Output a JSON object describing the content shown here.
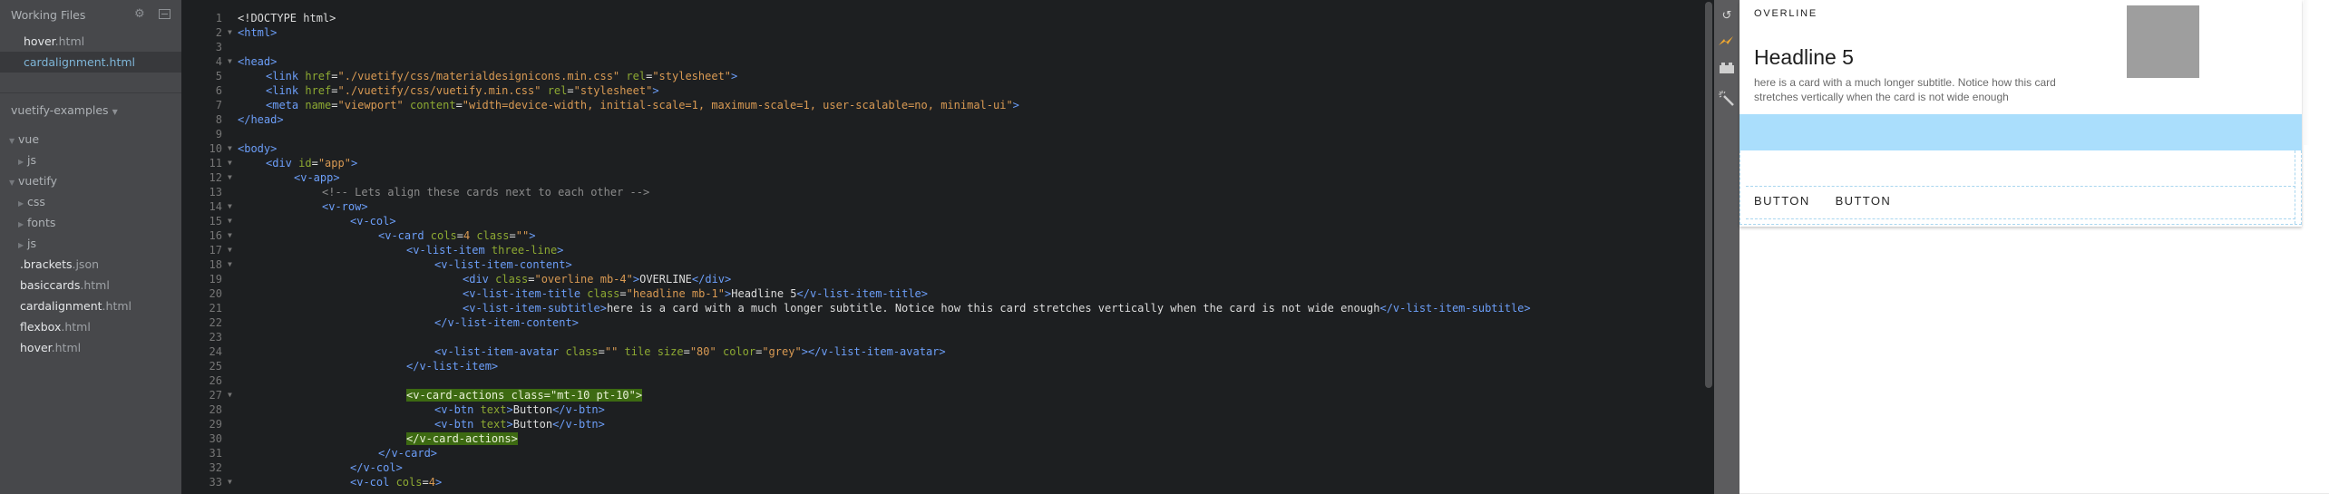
{
  "sidebar": {
    "working_files_title": "Working Files",
    "working_files": [
      {
        "base": "hover",
        "ext": ".html",
        "active": false
      },
      {
        "base": "cardalignment",
        "ext": ".html",
        "active": true
      }
    ],
    "project_title": "vuetify-examples",
    "tree": [
      {
        "depth": 0,
        "type": "folder",
        "open": true,
        "name": "vue"
      },
      {
        "depth": 1,
        "type": "folder",
        "open": false,
        "name": "js"
      },
      {
        "depth": 0,
        "type": "folder",
        "open": true,
        "name": "vuetify"
      },
      {
        "depth": 1,
        "type": "folder",
        "open": false,
        "name": "css"
      },
      {
        "depth": 1,
        "type": "folder",
        "open": false,
        "name": "fonts"
      },
      {
        "depth": 1,
        "type": "folder",
        "open": false,
        "name": "js"
      },
      {
        "depth": 0,
        "type": "file",
        "base": ".brackets",
        "ext": ".json"
      },
      {
        "depth": 0,
        "type": "file",
        "base": "basiccards",
        "ext": ".html"
      },
      {
        "depth": 0,
        "type": "file",
        "base": "cardalignment",
        "ext": ".html"
      },
      {
        "depth": 0,
        "type": "file",
        "base": "flexbox",
        "ext": ".html"
      },
      {
        "depth": 0,
        "type": "file",
        "base": "hover",
        "ext": ".html"
      }
    ]
  },
  "editor": {
    "lines": [
      {
        "n": 1,
        "fold": false,
        "indent": 0,
        "tokens": [
          [
            "p",
            "<!DOCTYPE html>"
          ]
        ]
      },
      {
        "n": 2,
        "fold": true,
        "indent": 0,
        "tokens": [
          [
            "t",
            "<html>"
          ]
        ]
      },
      {
        "n": 3,
        "fold": false,
        "indent": 0,
        "tokens": []
      },
      {
        "n": 4,
        "fold": true,
        "indent": 0,
        "tokens": [
          [
            "t",
            "<head>"
          ]
        ]
      },
      {
        "n": 5,
        "fold": false,
        "indent": 1,
        "tokens": [
          [
            "t",
            "<link "
          ],
          [
            "a",
            "href"
          ],
          [
            "p",
            "="
          ],
          [
            "s",
            "\"./vuetify/css/materialdesignicons.min.css\""
          ],
          [
            "p",
            " "
          ],
          [
            "a",
            "rel"
          ],
          [
            "p",
            "="
          ],
          [
            "s",
            "\"stylesheet\""
          ],
          [
            "t",
            ">"
          ]
        ]
      },
      {
        "n": 6,
        "fold": false,
        "indent": 1,
        "tokens": [
          [
            "t",
            "<link "
          ],
          [
            "a",
            "href"
          ],
          [
            "p",
            "="
          ],
          [
            "s",
            "\"./vuetify/css/vuetify.min.css\""
          ],
          [
            "p",
            " "
          ],
          [
            "a",
            "rel"
          ],
          [
            "p",
            "="
          ],
          [
            "s",
            "\"stylesheet\""
          ],
          [
            "t",
            ">"
          ]
        ]
      },
      {
        "n": 7,
        "fold": false,
        "indent": 1,
        "tokens": [
          [
            "t",
            "<meta "
          ],
          [
            "a",
            "name"
          ],
          [
            "p",
            "="
          ],
          [
            "s",
            "\"viewport\""
          ],
          [
            "p",
            " "
          ],
          [
            "a",
            "content"
          ],
          [
            "p",
            "="
          ],
          [
            "s",
            "\"width=device-width, initial-scale=1, maximum-scale=1, user-scalable=no, minimal-ui\""
          ],
          [
            "t",
            ">"
          ]
        ]
      },
      {
        "n": 8,
        "fold": false,
        "indent": 0,
        "tokens": [
          [
            "t",
            "</head>"
          ]
        ]
      },
      {
        "n": 9,
        "fold": false,
        "indent": 0,
        "tokens": []
      },
      {
        "n": 10,
        "fold": true,
        "indent": 0,
        "tokens": [
          [
            "t",
            "<body>"
          ]
        ]
      },
      {
        "n": 11,
        "fold": true,
        "indent": 1,
        "tokens": [
          [
            "t",
            "<div "
          ],
          [
            "a",
            "id"
          ],
          [
            "p",
            "="
          ],
          [
            "s",
            "\"app\""
          ],
          [
            "t",
            ">"
          ]
        ]
      },
      {
        "n": 12,
        "fold": true,
        "indent": 2,
        "tokens": [
          [
            "t",
            "<v-app>"
          ]
        ]
      },
      {
        "n": 13,
        "fold": false,
        "indent": 3,
        "tokens": [
          [
            "c",
            "<!-- Lets align these cards next to each other -->"
          ]
        ]
      },
      {
        "n": 14,
        "fold": true,
        "indent": 3,
        "tokens": [
          [
            "t",
            "<v-row>"
          ]
        ]
      },
      {
        "n": 15,
        "fold": true,
        "indent": 4,
        "tokens": [
          [
            "t",
            "<v-col>"
          ]
        ]
      },
      {
        "n": 16,
        "fold": true,
        "indent": 5,
        "tokens": [
          [
            "t",
            "<v-card "
          ],
          [
            "a",
            "cols"
          ],
          [
            "p",
            "="
          ],
          [
            "s",
            "4"
          ],
          [
            "p",
            " "
          ],
          [
            "a",
            "class"
          ],
          [
            "p",
            "="
          ],
          [
            "s",
            "\"\""
          ],
          [
            "t",
            ">"
          ]
        ]
      },
      {
        "n": 17,
        "fold": true,
        "indent": 6,
        "tokens": [
          [
            "t",
            "<v-list-item "
          ],
          [
            "a",
            "three-line"
          ],
          [
            "t",
            ">"
          ]
        ]
      },
      {
        "n": 18,
        "fold": true,
        "indent": 7,
        "tokens": [
          [
            "t",
            "<v-list-item-content>"
          ]
        ]
      },
      {
        "n": 19,
        "fold": false,
        "indent": 8,
        "tokens": [
          [
            "t",
            "<div "
          ],
          [
            "a",
            "class"
          ],
          [
            "p",
            "="
          ],
          [
            "s",
            "\"overline mb-4\""
          ],
          [
            "t",
            ">"
          ],
          [
            "p",
            "OVERLINE"
          ],
          [
            "t",
            "</div>"
          ]
        ]
      },
      {
        "n": 20,
        "fold": false,
        "indent": 8,
        "tokens": [
          [
            "t",
            "<v-list-item-title "
          ],
          [
            "a",
            "class"
          ],
          [
            "p",
            "="
          ],
          [
            "s",
            "\"headline mb-1\""
          ],
          [
            "t",
            ">"
          ],
          [
            "p",
            "Headline 5"
          ],
          [
            "t",
            "</v-list-item-title>"
          ]
        ]
      },
      {
        "n": 21,
        "fold": false,
        "indent": 8,
        "tokens": [
          [
            "t",
            "<v-list-item-subtitle>"
          ],
          [
            "p",
            "here is a card with a much longer subtitle. Notice how this card stretches vertically when the card is not wide enough"
          ],
          [
            "t",
            "</v-list-item-subtitle>"
          ]
        ]
      },
      {
        "n": 22,
        "fold": false,
        "indent": 7,
        "tokens": [
          [
            "t",
            "</v-list-item-content>"
          ]
        ]
      },
      {
        "n": 23,
        "fold": false,
        "indent": 0,
        "tokens": []
      },
      {
        "n": 24,
        "fold": false,
        "indent": 7,
        "tokens": [
          [
            "t",
            "<v-list-item-avatar "
          ],
          [
            "a",
            "class"
          ],
          [
            "p",
            "="
          ],
          [
            "s",
            "\"\""
          ],
          [
            "p",
            " "
          ],
          [
            "a",
            "tile"
          ],
          [
            "p",
            " "
          ],
          [
            "a",
            "size"
          ],
          [
            "p",
            "="
          ],
          [
            "s",
            "\"80\""
          ],
          [
            "p",
            " "
          ],
          [
            "a",
            "color"
          ],
          [
            "p",
            "="
          ],
          [
            "s",
            "\"grey\""
          ],
          [
            "t",
            "></v-list-item-avatar>"
          ]
        ]
      },
      {
        "n": 25,
        "fold": false,
        "indent": 6,
        "tokens": [
          [
            "t",
            "</v-list-item>"
          ]
        ]
      },
      {
        "n": 26,
        "fold": false,
        "indent": 0,
        "tokens": []
      },
      {
        "n": 27,
        "fold": true,
        "indent": 6,
        "highlight": true,
        "tokens": [
          [
            "hl",
            "<v-card-actions class=\"mt-10 pt-10\">"
          ]
        ]
      },
      {
        "n": 28,
        "fold": false,
        "indent": 7,
        "tokens": [
          [
            "t",
            "<v-btn "
          ],
          [
            "a",
            "text"
          ],
          [
            "t",
            ">"
          ],
          [
            "p",
            "Button"
          ],
          [
            "t",
            "</v-btn>"
          ]
        ]
      },
      {
        "n": 29,
        "fold": false,
        "indent": 7,
        "tokens": [
          [
            "t",
            "<v-btn "
          ],
          [
            "a",
            "text"
          ],
          [
            "t",
            ">"
          ],
          [
            "p",
            "Button"
          ],
          [
            "t",
            "</v-btn>"
          ]
        ]
      },
      {
        "n": 30,
        "fold": false,
        "indent": 6,
        "highlight": true,
        "tokens": [
          [
            "hl",
            "</v-card-actions>"
          ]
        ]
      },
      {
        "n": 31,
        "fold": false,
        "indent": 5,
        "tokens": [
          [
            "t",
            "</v-card>"
          ]
        ]
      },
      {
        "n": 32,
        "fold": false,
        "indent": 4,
        "tokens": [
          [
            "t",
            "</v-col>"
          ]
        ]
      },
      {
        "n": 33,
        "fold": true,
        "indent": 4,
        "tokens": [
          [
            "t",
            "<v-col "
          ],
          [
            "a",
            "cols"
          ],
          [
            "p",
            "="
          ],
          [
            "s",
            "4"
          ],
          [
            "t",
            ">"
          ]
        ]
      }
    ]
  },
  "toolbar": {
    "icons": [
      {
        "name": "live-preview-icon",
        "glyph": "↺"
      },
      {
        "name": "lightning-icon",
        "glyph": "⚡"
      },
      {
        "name": "extension-manager-icon",
        "glyph": "▬"
      },
      {
        "name": "magic-wand-icon",
        "glyph": "⚚"
      }
    ]
  },
  "preview": {
    "overline": "OVERLINE",
    "headline": "Headline 5",
    "subtitle": "here is a card with a much longer subtitle. Notice how this card stretches vertically when the card is not wide enough",
    "avatar_color": "#9e9e9e",
    "buttons": [
      "BUTTON",
      "BUTTON"
    ]
  }
}
